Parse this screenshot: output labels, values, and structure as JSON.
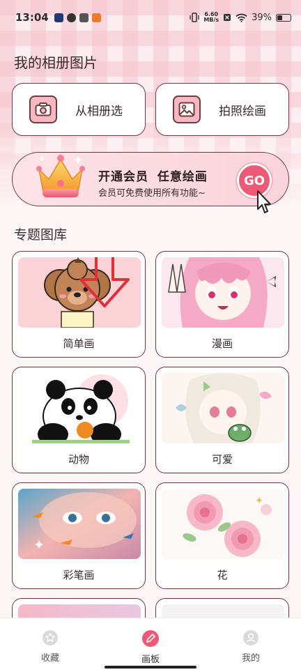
{
  "status_bar": {
    "time": "13:04",
    "net_speed_value": "6.60",
    "net_speed_unit": "MB/s",
    "battery": "39%",
    "battery_level": 0.39
  },
  "page_title": "我的相册图片",
  "actions": {
    "album_label": "从相册选",
    "photo_label": "拍照绘画"
  },
  "vip": {
    "title": "开通会员 任意绘画",
    "subtitle": "会员可免费使用所有功能~",
    "go_label": "GO"
  },
  "section_title": "专题图库",
  "categories": [
    {
      "label": "简单画"
    },
    {
      "label": "漫画"
    },
    {
      "label": "动物"
    },
    {
      "label": "可爱"
    },
    {
      "label": "彩笔画"
    },
    {
      "label": "花"
    }
  ],
  "bottom_nav": {
    "favorites": "收藏",
    "drawing": "画板",
    "mine": "我的"
  },
  "colors": {
    "accent": "#ec5a75",
    "border": "#6e3a3f",
    "pink_light": "#fde3e8"
  }
}
